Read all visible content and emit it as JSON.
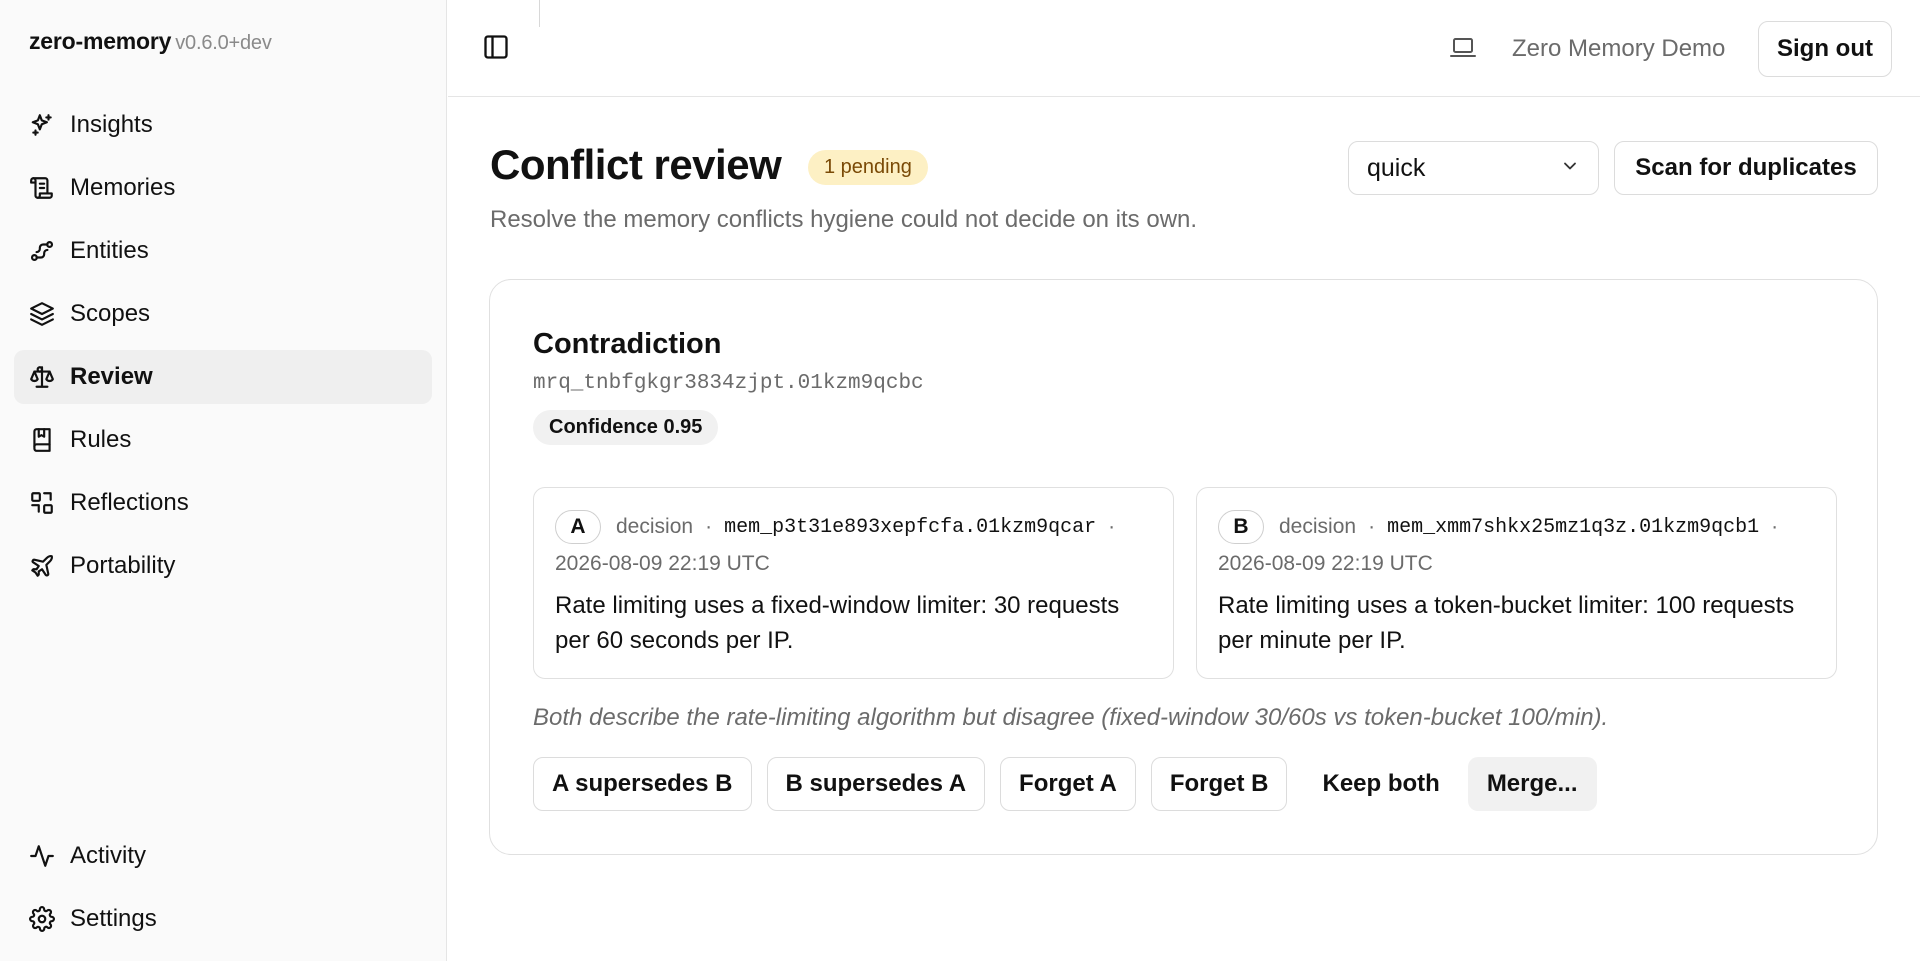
{
  "app": {
    "name": "zero-memory",
    "version": "v0.6.0+dev"
  },
  "sidebar": {
    "items": [
      {
        "label": "Insights",
        "icon": "sparkles-icon"
      },
      {
        "label": "Memories",
        "icon": "scroll-icon"
      },
      {
        "label": "Entities",
        "icon": "network-icon"
      },
      {
        "label": "Scopes",
        "icon": "layers-icon"
      },
      {
        "label": "Review",
        "icon": "scale-icon",
        "active": true
      },
      {
        "label": "Rules",
        "icon": "book-icon"
      },
      {
        "label": "Reflections",
        "icon": "grid-icon"
      },
      {
        "label": "Portability",
        "icon": "plane-icon"
      }
    ],
    "bottom_items": [
      {
        "label": "Activity",
        "icon": "activity-icon"
      },
      {
        "label": "Settings",
        "icon": "gear-icon"
      }
    ]
  },
  "header": {
    "tenant": "Zero Memory Demo",
    "signout_label": "Sign out",
    "icons": [
      "sidebar-toggle-icon",
      "laptop-icon"
    ]
  },
  "page": {
    "title": "Conflict review",
    "pending_badge": "1 pending",
    "subtitle": "Resolve the memory conflicts hygiene could not decide on its own.",
    "mode_select": {
      "value": "quick"
    },
    "scan_label": "Scan for duplicates"
  },
  "conflict": {
    "kind": "Contradiction",
    "id": "mrq_tnbfgkgr3834zjpt.01kzm9qcbc",
    "confidence": "Confidence 0.95",
    "memory_a": {
      "letter": "A",
      "type": "decision",
      "id": "mem_p3t31e893xepfcfa.01kzm9qcar",
      "timestamp": "2026-08-09 22:19 UTC",
      "text": "Rate limiting uses a fixed-window limiter: 30 requests per 60 seconds per IP."
    },
    "memory_b": {
      "letter": "B",
      "type": "decision",
      "id": "mem_xmm7shkx25mz1q3z.01kzm9qcb1",
      "timestamp": "2026-08-09 22:19 UTC",
      "text": "Rate limiting uses a token-bucket limiter: 100 requests per minute per IP."
    },
    "rationale": "Both describe the rate-limiting algorithm but disagree (fixed-window 30/60s vs token-bucket 100/min).",
    "actions": {
      "a_supersedes_b": "A supersedes B",
      "b_supersedes_a": "B supersedes A",
      "forget_a": "Forget A",
      "forget_b": "Forget B",
      "keep_both": "Keep both",
      "merge": "Merge..."
    }
  },
  "colors": {
    "pending_badge_bg": "#fdf0c4",
    "pending_badge_text": "#7a4a06",
    "sidebar_bg": "#fafafa",
    "active_item_bg": "#efefef"
  }
}
